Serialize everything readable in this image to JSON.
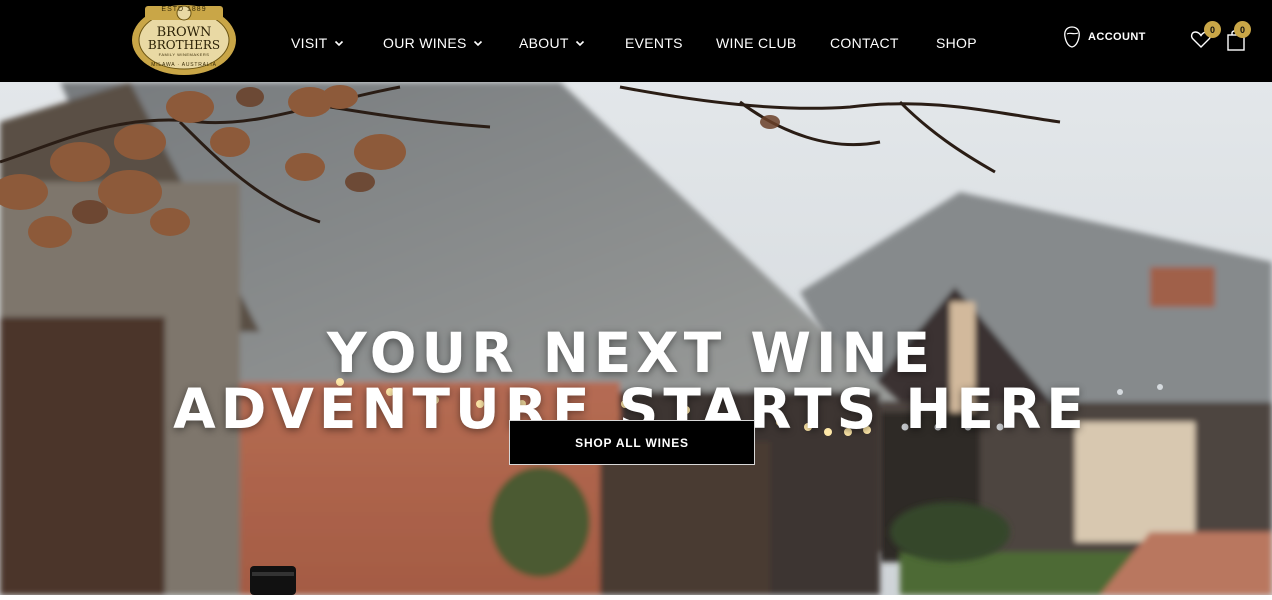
{
  "brand": {
    "logo_est": "ESTD 1889",
    "logo_name_line1": "BROWN",
    "logo_name_line2": "BROTHERS",
    "logo_sub": "FAMILY WINEMAKERS",
    "logo_location": "MILAWA · AUSTRALIA"
  },
  "nav": {
    "items": [
      {
        "label": "VISIT",
        "has_dropdown": true
      },
      {
        "label": "OUR WINES",
        "has_dropdown": true
      },
      {
        "label": "ABOUT",
        "has_dropdown": true
      },
      {
        "label": "EVENTS",
        "has_dropdown": false
      },
      {
        "label": "WINE CLUB",
        "has_dropdown": false
      },
      {
        "label": "CONTACT",
        "has_dropdown": false
      },
      {
        "label": "SHOP",
        "has_dropdown": false
      }
    ],
    "account_label": "ACCOUNT",
    "wishlist_count": "0",
    "cart_count": "0"
  },
  "hero": {
    "title_line1": "YOUR NEXT WINE",
    "title_line2": "ADVENTURE STARTS HERE",
    "cta_label": "SHOP ALL WINES"
  },
  "colors": {
    "nav_bg": "#000000",
    "gold": "#c9a647",
    "text": "#ffffff"
  },
  "icons": [
    "chevron-down-icon",
    "account-icon",
    "heart-icon",
    "bag-icon"
  ]
}
